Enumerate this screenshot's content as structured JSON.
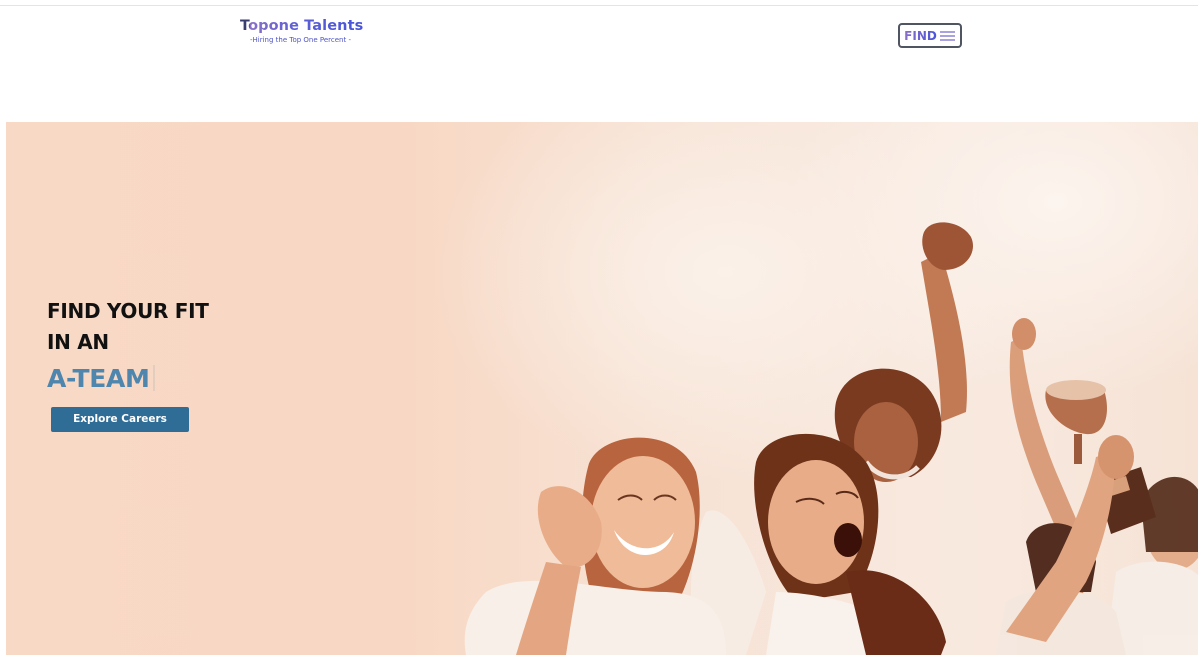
{
  "header": {
    "brand_name": "Topone Talents",
    "brand_tagline": "-Hiring the Top One Percent -",
    "find_button_label": "FIND",
    "menu_icon": "hamburger-menu-icon"
  },
  "hero": {
    "headline_line1": "FIND YOUR FIT",
    "headline_line2": "IN AN",
    "headline_accent": "A-TEAM",
    "cta_label": "Explore Careers",
    "photo_subject": "celebrating-women-with-trophy"
  },
  "colors": {
    "accent_blue": "#4e86ad",
    "button_blue": "#2f6d97",
    "brand_purple": "#5b5fd6",
    "hero_tint": "#f8d9c5"
  }
}
